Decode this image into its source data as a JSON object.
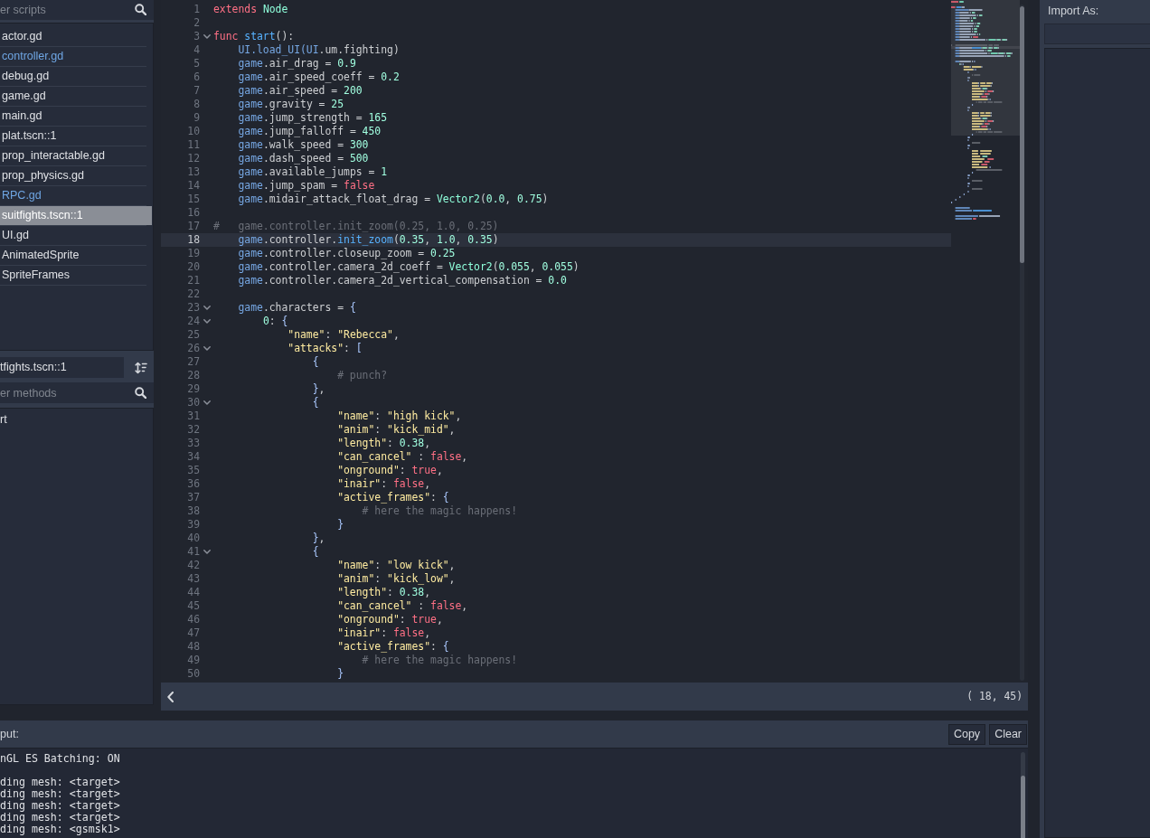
{
  "script_panel": {
    "filter": {
      "placeholder": "er scripts"
    },
    "scripts": [
      {
        "label": "actor.gd",
        "color": "#dfe1e5",
        "selected": false
      },
      {
        "label": "controller.gd",
        "color": "#6fa6e4",
        "selected": false
      },
      {
        "label": "debug.gd",
        "color": "#dfe1e5",
        "selected": false
      },
      {
        "label": "game.gd",
        "color": "#dfe1e5",
        "selected": false
      },
      {
        "label": "main.gd",
        "color": "#dfe1e5",
        "selected": false
      },
      {
        "label": "plat.tscn::1",
        "color": "#dfe1e5",
        "selected": false
      },
      {
        "label": "prop_interactable.gd",
        "color": "#dfe1e5",
        "selected": false
      },
      {
        "label": "prop_physics.gd",
        "color": "#dfe1e5",
        "selected": false
      },
      {
        "label": "RPC.gd",
        "color": "#6fa6e4",
        "selected": false
      },
      {
        "label": "suitfights.tscn::1",
        "selected": true
      },
      {
        "label": "UI.gd",
        "color": "#dfe1e5",
        "selected": false
      },
      {
        "label": "AnimatedSprite",
        "color": "#dfe1e5",
        "selected": false
      },
      {
        "label": "SpriteFrames",
        "color": "#dfe1e5",
        "selected": false
      }
    ]
  },
  "members_panel": {
    "current_script": {
      "value": "tfights.tscn::1"
    },
    "filter": {
      "placeholder": "er methods"
    },
    "methods": [
      "rt"
    ]
  },
  "editor": {
    "lines": [
      {
        "number": "1",
        "foldable": false,
        "current": false,
        "tokens": [
          {
            "kind": "keyword",
            "text": "extends "
          },
          {
            "kind": "type",
            "text": "Node"
          }
        ]
      },
      {
        "number": "2",
        "foldable": false,
        "current": false
      },
      {
        "number": "3",
        "foldable": true,
        "current": false,
        "tokens": [
          {
            "kind": "keyword",
            "text": "func "
          },
          {
            "kind": "function",
            "text": "start"
          },
          {
            "kind": "plain",
            "text": "():"
          }
        ]
      },
      {
        "number": "4",
        "foldable": false,
        "current": false,
        "tokens": [
          {
            "kind": "member",
            "text": "    UI.load_UI(UI"
          },
          {
            "kind": "plain",
            "text": ".um.fighting)"
          }
        ]
      },
      {
        "number": "5",
        "foldable": false,
        "current": false,
        "tokens": [
          {
            "kind": "member",
            "text": "    game"
          },
          {
            "kind": "plain",
            "text": ".air_drag = "
          },
          {
            "kind": "number",
            "text": "0.9"
          }
        ]
      },
      {
        "number": "6",
        "foldable": false,
        "current": false,
        "tokens": [
          {
            "kind": "member",
            "text": "    game"
          },
          {
            "kind": "plain",
            "text": ".air_speed_coeff = "
          },
          {
            "kind": "number",
            "text": "0.2"
          }
        ]
      },
      {
        "number": "7",
        "foldable": false,
        "current": false,
        "tokens": [
          {
            "kind": "member",
            "text": "    game"
          },
          {
            "kind": "plain",
            "text": ".air_speed = "
          },
          {
            "kind": "number",
            "text": "200"
          }
        ]
      },
      {
        "number": "8",
        "foldable": false,
        "current": false,
        "tokens": [
          {
            "kind": "member",
            "text": "    game"
          },
          {
            "kind": "plain",
            "text": ".gravity = "
          },
          {
            "kind": "number",
            "text": "25"
          }
        ]
      },
      {
        "number": "9",
        "foldable": false,
        "current": false,
        "tokens": [
          {
            "kind": "member",
            "text": "    game"
          },
          {
            "kind": "plain",
            "text": ".jump_strength = "
          },
          {
            "kind": "number",
            "text": "165"
          }
        ]
      },
      {
        "number": "10",
        "foldable": false,
        "current": false,
        "tokens": [
          {
            "kind": "member",
            "text": "    game"
          },
          {
            "kind": "plain",
            "text": ".jump_falloff = "
          },
          {
            "kind": "number",
            "text": "450"
          }
        ]
      },
      {
        "number": "11",
        "foldable": false,
        "current": false,
        "tokens": [
          {
            "kind": "member",
            "text": "    game"
          },
          {
            "kind": "plain",
            "text": ".walk_speed = "
          },
          {
            "kind": "number",
            "text": "300"
          }
        ]
      },
      {
        "number": "12",
        "foldable": false,
        "current": false,
        "tokens": [
          {
            "kind": "member",
            "text": "    game"
          },
          {
            "kind": "plain",
            "text": ".dash_speed = "
          },
          {
            "kind": "number",
            "text": "500"
          }
        ]
      },
      {
        "number": "13",
        "foldable": false,
        "current": false,
        "tokens": [
          {
            "kind": "member",
            "text": "    game"
          },
          {
            "kind": "plain",
            "text": ".available_jumps = "
          },
          {
            "kind": "number",
            "text": "1"
          }
        ]
      },
      {
        "number": "14",
        "foldable": false,
        "current": false,
        "tokens": [
          {
            "kind": "member",
            "text": "    game"
          },
          {
            "kind": "plain",
            "text": ".jump_spam = "
          },
          {
            "kind": "keyword",
            "text": "false"
          }
        ]
      },
      {
        "number": "15",
        "foldable": false,
        "current": false,
        "tokens": [
          {
            "kind": "member",
            "text": "    game"
          },
          {
            "kind": "plain",
            "text": ".midair_attack_float_drag = "
          },
          {
            "kind": "type",
            "text": "Vector2"
          },
          {
            "kind": "plain",
            "text": "("
          },
          {
            "kind": "number",
            "text": "0.0"
          },
          {
            "kind": "plain",
            "text": ", "
          },
          {
            "kind": "number",
            "text": "0.75"
          },
          {
            "kind": "plain",
            "text": ")"
          }
        ]
      },
      {
        "number": "16",
        "foldable": false,
        "current": false
      },
      {
        "number": "17",
        "foldable": false,
        "current": false,
        "tokens": [
          {
            "kind": "comment",
            "text": "#   game.controller.init_zoom(0.25, 1.0, 0.25)"
          }
        ]
      },
      {
        "number": "18",
        "foldable": false,
        "current": true,
        "tokens": [
          {
            "kind": "member",
            "text": "    game"
          },
          {
            "kind": "plain",
            "text": ".controller."
          },
          {
            "kind": "function",
            "text": "init_zoom"
          },
          {
            "kind": "plain",
            "text": "("
          },
          {
            "kind": "number",
            "text": "0.35"
          },
          {
            "kind": "plain",
            "text": ", "
          },
          {
            "kind": "number",
            "text": "1.0"
          },
          {
            "kind": "plain",
            "text": ", "
          },
          {
            "kind": "number",
            "text": "0.35"
          },
          {
            "kind": "plain",
            "text": ")"
          }
        ]
      },
      {
        "number": "19",
        "foldable": false,
        "current": false,
        "tokens": [
          {
            "kind": "member",
            "text": "    game"
          },
          {
            "kind": "plain",
            "text": ".controller.closeup_zoom = "
          },
          {
            "kind": "number",
            "text": "0.25"
          }
        ]
      },
      {
        "number": "20",
        "foldable": false,
        "current": false,
        "tokens": [
          {
            "kind": "member",
            "text": "    game"
          },
          {
            "kind": "plain",
            "text": ".controller.camera_2d_coeff = "
          },
          {
            "kind": "type",
            "text": "Vector2"
          },
          {
            "kind": "plain",
            "text": "("
          },
          {
            "kind": "number",
            "text": "0.055"
          },
          {
            "kind": "plain",
            "text": ", "
          },
          {
            "kind": "number",
            "text": "0.055"
          },
          {
            "kind": "plain",
            "text": ")"
          }
        ]
      },
      {
        "number": "21",
        "foldable": false,
        "current": false,
        "tokens": [
          {
            "kind": "member",
            "text": "    game"
          },
          {
            "kind": "plain",
            "text": ".controller.camera_2d_vertical_compensation = "
          },
          {
            "kind": "number",
            "text": "0.0"
          }
        ]
      },
      {
        "number": "22",
        "foldable": false,
        "current": false
      },
      {
        "number": "23",
        "foldable": true,
        "current": false,
        "tokens": [
          {
            "kind": "member",
            "text": "    game"
          },
          {
            "kind": "plain",
            "text": ".characters = "
          },
          {
            "kind": "symbol",
            "text": "{"
          }
        ]
      },
      {
        "number": "24",
        "foldable": true,
        "current": false,
        "tokens": [
          {
            "kind": "number",
            "text": "        0"
          },
          {
            "kind": "plain",
            "text": ": "
          },
          {
            "kind": "symbol",
            "text": "{"
          }
        ]
      },
      {
        "number": "25",
        "foldable": false,
        "current": false,
        "tokens": [
          {
            "kind": "string",
            "text": "            \"name\""
          },
          {
            "kind": "plain",
            "text": ": "
          },
          {
            "kind": "string",
            "text": "\"Rebecca\""
          },
          {
            "kind": "plain",
            "text": ","
          }
        ]
      },
      {
        "number": "26",
        "foldable": true,
        "current": false,
        "tokens": [
          {
            "kind": "string",
            "text": "            \"attacks\""
          },
          {
            "kind": "plain",
            "text": ": "
          },
          {
            "kind": "symbol",
            "text": "["
          }
        ]
      },
      {
        "number": "27",
        "foldable": false,
        "current": false,
        "tokens": [
          {
            "kind": "symbol",
            "text": "                {"
          }
        ]
      },
      {
        "number": "28",
        "foldable": false,
        "current": false,
        "tokens": [
          {
            "kind": "comment",
            "text": "                    # punch?"
          }
        ]
      },
      {
        "number": "29",
        "foldable": false,
        "current": false,
        "tokens": [
          {
            "kind": "symbol",
            "text": "                }"
          },
          {
            "kind": "plain",
            "text": ","
          }
        ]
      },
      {
        "number": "30",
        "foldable": true,
        "current": false,
        "tokens": [
          {
            "kind": "symbol",
            "text": "                {"
          }
        ]
      },
      {
        "number": "31",
        "foldable": false,
        "current": false,
        "tokens": [
          {
            "kind": "string",
            "text": "                    \"name\""
          },
          {
            "kind": "plain",
            "text": ": "
          },
          {
            "kind": "string",
            "text": "\"high kick\""
          },
          {
            "kind": "plain",
            "text": ","
          }
        ]
      },
      {
        "number": "32",
        "foldable": false,
        "current": false,
        "tokens": [
          {
            "kind": "string",
            "text": "                    \"anim\""
          },
          {
            "kind": "plain",
            "text": ": "
          },
          {
            "kind": "string",
            "text": "\"kick_mid\""
          },
          {
            "kind": "plain",
            "text": ","
          }
        ]
      },
      {
        "number": "33",
        "foldable": false,
        "current": false,
        "tokens": [
          {
            "kind": "string",
            "text": "                    \"length\""
          },
          {
            "kind": "plain",
            "text": ": "
          },
          {
            "kind": "number",
            "text": "0.38"
          },
          {
            "kind": "plain",
            "text": ","
          }
        ]
      },
      {
        "number": "34",
        "foldable": false,
        "current": false,
        "tokens": [
          {
            "kind": "string",
            "text": "                    \"can_cancel\""
          },
          {
            "kind": "plain",
            "text": " : "
          },
          {
            "kind": "keyword",
            "text": "false"
          },
          {
            "kind": "plain",
            "text": ","
          }
        ]
      },
      {
        "number": "35",
        "foldable": false,
        "current": false,
        "tokens": [
          {
            "kind": "string",
            "text": "                    \"onground\""
          },
          {
            "kind": "plain",
            "text": ": "
          },
          {
            "kind": "keyword",
            "text": "true"
          },
          {
            "kind": "plain",
            "text": ","
          }
        ]
      },
      {
        "number": "36",
        "foldable": false,
        "current": false,
        "tokens": [
          {
            "kind": "string",
            "text": "                    \"inair\""
          },
          {
            "kind": "plain",
            "text": ": "
          },
          {
            "kind": "keyword",
            "text": "false"
          },
          {
            "kind": "plain",
            "text": ","
          }
        ]
      },
      {
        "number": "37",
        "foldable": false,
        "current": false,
        "tokens": [
          {
            "kind": "string",
            "text": "                    \"active_frames\""
          },
          {
            "kind": "plain",
            "text": ": "
          },
          {
            "kind": "symbol",
            "text": "{"
          }
        ]
      },
      {
        "number": "38",
        "foldable": false,
        "current": false,
        "tokens": [
          {
            "kind": "comment",
            "text": "                        # here the magic happens!"
          }
        ]
      },
      {
        "number": "39",
        "foldable": false,
        "current": false,
        "tokens": [
          {
            "kind": "symbol",
            "text": "                    }"
          }
        ]
      },
      {
        "number": "40",
        "foldable": false,
        "current": false,
        "tokens": [
          {
            "kind": "symbol",
            "text": "                }"
          },
          {
            "kind": "plain",
            "text": ","
          }
        ]
      },
      {
        "number": "41",
        "foldable": true,
        "current": false,
        "tokens": [
          {
            "kind": "symbol",
            "text": "                {"
          }
        ]
      },
      {
        "number": "42",
        "foldable": false,
        "current": false,
        "tokens": [
          {
            "kind": "string",
            "text": "                    \"name\""
          },
          {
            "kind": "plain",
            "text": ": "
          },
          {
            "kind": "string",
            "text": "\"low kick\""
          },
          {
            "kind": "plain",
            "text": ","
          }
        ]
      },
      {
        "number": "43",
        "foldable": false,
        "current": false,
        "tokens": [
          {
            "kind": "string",
            "text": "                    \"anim\""
          },
          {
            "kind": "plain",
            "text": ": "
          },
          {
            "kind": "string",
            "text": "\"kick_low\""
          },
          {
            "kind": "plain",
            "text": ","
          }
        ]
      },
      {
        "number": "44",
        "foldable": false,
        "current": false,
        "tokens": [
          {
            "kind": "string",
            "text": "                    \"length\""
          },
          {
            "kind": "plain",
            "text": ": "
          },
          {
            "kind": "number",
            "text": "0.38"
          },
          {
            "kind": "plain",
            "text": ","
          }
        ]
      },
      {
        "number": "45",
        "foldable": false,
        "current": false,
        "tokens": [
          {
            "kind": "string",
            "text": "                    \"can_cancel\""
          },
          {
            "kind": "plain",
            "text": " : "
          },
          {
            "kind": "keyword",
            "text": "false"
          },
          {
            "kind": "plain",
            "text": ","
          }
        ]
      },
      {
        "number": "46",
        "foldable": false,
        "current": false,
        "tokens": [
          {
            "kind": "string",
            "text": "                    \"onground\""
          },
          {
            "kind": "plain",
            "text": ": "
          },
          {
            "kind": "keyword",
            "text": "true"
          },
          {
            "kind": "plain",
            "text": ","
          }
        ]
      },
      {
        "number": "47",
        "foldable": false,
        "current": false,
        "tokens": [
          {
            "kind": "string",
            "text": "                    \"inair\""
          },
          {
            "kind": "plain",
            "text": ": "
          },
          {
            "kind": "keyword",
            "text": "false"
          },
          {
            "kind": "plain",
            "text": ","
          }
        ]
      },
      {
        "number": "48",
        "foldable": false,
        "current": false,
        "tokens": [
          {
            "kind": "string",
            "text": "                    \"active_frames\""
          },
          {
            "kind": "plain",
            "text": ": "
          },
          {
            "kind": "symbol",
            "text": "{"
          }
        ]
      },
      {
        "number": "49",
        "foldable": false,
        "current": false,
        "tokens": [
          {
            "kind": "comment",
            "text": "                        # here the magic happens!"
          }
        ]
      },
      {
        "number": "50",
        "foldable": false,
        "current": false,
        "tokens": [
          {
            "kind": "symbol",
            "text": "                    }"
          }
        ]
      }
    ],
    "cursor_position": "( 18, 45)"
  },
  "output": {
    "title": "put:",
    "buttons": [
      "Copy",
      "Clear"
    ],
    "groups": [
      {
        "lines": [
          "nGL ES Batching: ON"
        ]
      },
      {
        "lines": [
          "ding mesh: <target>",
          "ding mesh: <target>",
          "ding mesh: <target>",
          "ding mesh: <target>",
          "ding mesh: <gsmsk1>"
        ]
      }
    ]
  },
  "import_dock": {
    "title": "Import As:"
  }
}
